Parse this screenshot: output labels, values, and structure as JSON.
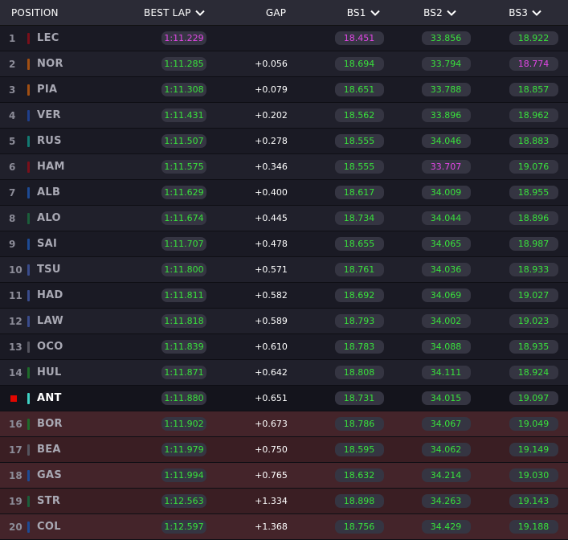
{
  "header": {
    "position": "POSITION",
    "best_lap": "BEST LAP",
    "gap": "GAP",
    "bs1": "BS1",
    "bs2": "BS2",
    "bs3": "BS3"
  },
  "colors": {
    "green_time": "#39e23c",
    "purple_time": "#e447e8",
    "elimination_zone": "#3a1e23"
  },
  "rows": [
    {
      "pos": "1",
      "code": "LEC",
      "team": "#7a0f1a",
      "best": "1:11.229",
      "best_purple": true,
      "gap": "",
      "bs1": "18.451",
      "bs1_purple": true,
      "bs2": "33.856",
      "bs2_purple": false,
      "bs3": "18.922",
      "bs3_purple": false,
      "elim": false,
      "me": false
    },
    {
      "pos": "2",
      "code": "NOR",
      "team": "#a24f12",
      "best": "1:11.285",
      "best_purple": false,
      "gap": "+0.056",
      "bs1": "18.694",
      "bs1_purple": false,
      "bs2": "33.794",
      "bs2_purple": false,
      "bs3": "18.774",
      "bs3_purple": true,
      "elim": false,
      "me": false
    },
    {
      "pos": "3",
      "code": "PIA",
      "team": "#a24f12",
      "best": "1:11.308",
      "best_purple": false,
      "gap": "+0.079",
      "bs1": "18.651",
      "bs1_purple": false,
      "bs2": "33.788",
      "bs2_purple": false,
      "bs3": "18.857",
      "bs3_purple": false,
      "elim": false,
      "me": false
    },
    {
      "pos": "4",
      "code": "VER",
      "team": "#1f3f8c",
      "best": "1:11.431",
      "best_purple": false,
      "gap": "+0.202",
      "bs1": "18.562",
      "bs1_purple": false,
      "bs2": "33.896",
      "bs2_purple": false,
      "bs3": "18.962",
      "bs3_purple": false,
      "elim": false,
      "me": false
    },
    {
      "pos": "5",
      "code": "RUS",
      "team": "#127a72",
      "best": "1:11.507",
      "best_purple": false,
      "gap": "+0.278",
      "bs1": "18.555",
      "bs1_purple": false,
      "bs2": "34.046",
      "bs2_purple": false,
      "bs3": "18.883",
      "bs3_purple": false,
      "elim": false,
      "me": false
    },
    {
      "pos": "6",
      "code": "HAM",
      "team": "#7a0f1a",
      "best": "1:11.575",
      "best_purple": false,
      "gap": "+0.346",
      "bs1": "18.555",
      "bs1_purple": false,
      "bs2": "33.707",
      "bs2_purple": true,
      "bs3": "19.076",
      "bs3_purple": false,
      "elim": false,
      "me": false
    },
    {
      "pos": "7",
      "code": "ALB",
      "team": "#1d4a94",
      "best": "1:11.629",
      "best_purple": false,
      "gap": "+0.400",
      "bs1": "18.617",
      "bs1_purple": false,
      "bs2": "34.009",
      "bs2_purple": false,
      "bs3": "18.955",
      "bs3_purple": false,
      "elim": false,
      "me": false
    },
    {
      "pos": "8",
      "code": "ALO",
      "team": "#1b5e3a",
      "best": "1:11.674",
      "best_purple": false,
      "gap": "+0.445",
      "bs1": "18.734",
      "bs1_purple": false,
      "bs2": "34.044",
      "bs2_purple": false,
      "bs3": "18.896",
      "bs3_purple": false,
      "elim": false,
      "me": false
    },
    {
      "pos": "9",
      "code": "SAI",
      "team": "#1d4a94",
      "best": "1:11.707",
      "best_purple": false,
      "gap": "+0.478",
      "bs1": "18.655",
      "bs1_purple": false,
      "bs2": "34.065",
      "bs2_purple": false,
      "bs3": "18.987",
      "bs3_purple": false,
      "elim": false,
      "me": false
    },
    {
      "pos": "10",
      "code": "TSU",
      "team": "#3a4c8c",
      "best": "1:11.800",
      "best_purple": false,
      "gap": "+0.571",
      "bs1": "18.761",
      "bs1_purple": false,
      "bs2": "34.036",
      "bs2_purple": false,
      "bs3": "18.933",
      "bs3_purple": false,
      "elim": false,
      "me": false
    },
    {
      "pos": "11",
      "code": "HAD",
      "team": "#3a4c8c",
      "best": "1:11.811",
      "best_purple": false,
      "gap": "+0.582",
      "bs1": "18.692",
      "bs1_purple": false,
      "bs2": "34.069",
      "bs2_purple": false,
      "bs3": "19.027",
      "bs3_purple": false,
      "elim": false,
      "me": false
    },
    {
      "pos": "12",
      "code": "LAW",
      "team": "#3a4c8c",
      "best": "1:11.818",
      "best_purple": false,
      "gap": "+0.589",
      "bs1": "18.793",
      "bs1_purple": false,
      "bs2": "34.002",
      "bs2_purple": false,
      "bs3": "19.023",
      "bs3_purple": false,
      "elim": false,
      "me": false
    },
    {
      "pos": "13",
      "code": "OCO",
      "team": "#55555f",
      "best": "1:11.839",
      "best_purple": false,
      "gap": "+0.610",
      "bs1": "18.783",
      "bs1_purple": false,
      "bs2": "34.088",
      "bs2_purple": false,
      "bs3": "18.935",
      "bs3_purple": false,
      "elim": false,
      "me": false
    },
    {
      "pos": "14",
      "code": "HUL",
      "team": "#1e6b2a",
      "best": "1:11.871",
      "best_purple": false,
      "gap": "+0.642",
      "bs1": "18.808",
      "bs1_purple": false,
      "bs2": "34.111",
      "bs2_purple": false,
      "bs3": "18.924",
      "bs3_purple": false,
      "elim": false,
      "me": false
    },
    {
      "pos": "",
      "code": "ANT",
      "team": "#3fd3c5",
      "best": "1:11.880",
      "best_purple": false,
      "gap": "+0.651",
      "bs1": "18.731",
      "bs1_purple": false,
      "bs2": "34.015",
      "bs2_purple": false,
      "bs3": "19.097",
      "bs3_purple": false,
      "elim": false,
      "me": true
    },
    {
      "pos": "16",
      "code": "BOR",
      "team": "#1e6b2a",
      "best": "1:11.902",
      "best_purple": false,
      "gap": "+0.673",
      "bs1": "18.786",
      "bs1_purple": false,
      "bs2": "34.067",
      "bs2_purple": false,
      "bs3": "19.049",
      "bs3_purple": false,
      "elim": true,
      "me": false
    },
    {
      "pos": "17",
      "code": "BEA",
      "team": "#55555f",
      "best": "1:11.979",
      "best_purple": false,
      "gap": "+0.750",
      "bs1": "18.595",
      "bs1_purple": false,
      "bs2": "34.062",
      "bs2_purple": false,
      "bs3": "19.149",
      "bs3_purple": false,
      "elim": true,
      "me": false
    },
    {
      "pos": "18",
      "code": "GAS",
      "team": "#1d4a94",
      "best": "1:11.994",
      "best_purple": false,
      "gap": "+0.765",
      "bs1": "18.632",
      "bs1_purple": false,
      "bs2": "34.214",
      "bs2_purple": false,
      "bs3": "19.030",
      "bs3_purple": false,
      "elim": true,
      "me": false
    },
    {
      "pos": "19",
      "code": "STR",
      "team": "#1b5e3a",
      "best": "1:12.563",
      "best_purple": false,
      "gap": "+1.334",
      "bs1": "18.898",
      "bs1_purple": false,
      "bs2": "34.263",
      "bs2_purple": false,
      "bs3": "19.143",
      "bs3_purple": false,
      "elim": true,
      "me": false
    },
    {
      "pos": "20",
      "code": "COL",
      "team": "#1d4a94",
      "best": "1:12.597",
      "best_purple": false,
      "gap": "+1.368",
      "bs1": "18.756",
      "bs1_purple": false,
      "bs2": "34.429",
      "bs2_purple": false,
      "bs3": "19.188",
      "bs3_purple": false,
      "elim": true,
      "me": false
    }
  ]
}
